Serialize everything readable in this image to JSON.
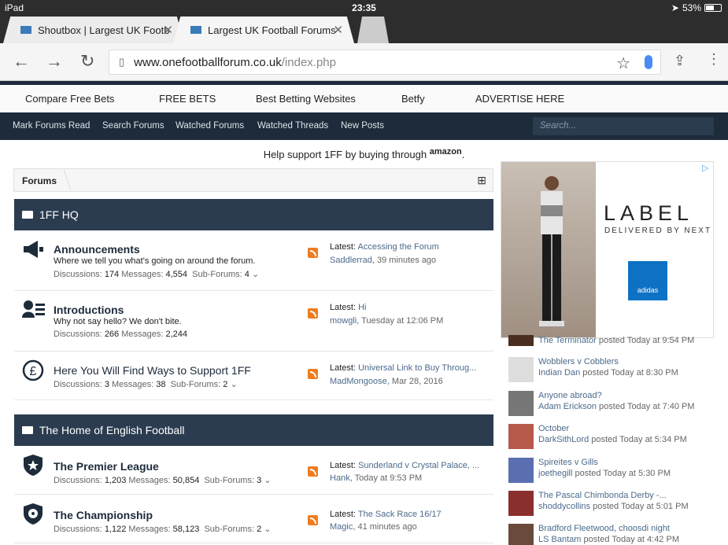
{
  "status_bar": {
    "device": "iPad",
    "time": "23:35",
    "battery": "53%"
  },
  "tabs": [
    {
      "label": "Shoutbox | Largest UK Footb",
      "active": false
    },
    {
      "label": "Largest UK Football Forums",
      "active": true
    }
  ],
  "address": {
    "host": "www.onefootballforum.co.uk",
    "path": "/index.php"
  },
  "sponsor_links": [
    "Compare Free Bets",
    "FREE BETS",
    "Best Betting Websites",
    "Betfy",
    "ADVERTISE HERE"
  ],
  "forum_nav": {
    "links": [
      "Mark Forums Read",
      "Search Forums",
      "Watched Forums",
      "Watched Threads",
      "New Posts"
    ],
    "search_placeholder": "Search..."
  },
  "support": {
    "text": "Help support 1FF by buying through",
    "brand": "amazon",
    "suffix": "."
  },
  "breadcrumb": {
    "label": "Forums"
  },
  "categories": [
    {
      "title": "1FF HQ",
      "nodes": [
        {
          "title": "Announcements",
          "desc": "Where we tell you what's going on around the forum.",
          "discussions": "174",
          "messages": "4,554",
          "subforums": "4",
          "latest": "Accessing the Forum",
          "by": "Saddlerrad",
          "time": "39 minutes ago"
        },
        {
          "title": "Introductions",
          "desc": "Why not say hello? We don't bite.",
          "discussions": "266",
          "messages": "2,244",
          "subforums": "",
          "latest": "Hi",
          "by": "mowgli",
          "time": "Tuesday at 12:06 PM"
        },
        {
          "title": "Here You Will Find Ways to Support 1FF",
          "desc": "",
          "discussions": "3",
          "messages": "38",
          "subforums": "2",
          "latest": "Universal Link to Buy Throug...",
          "by": "MadMongoose",
          "time": "Mar 28, 2016"
        }
      ]
    },
    {
      "title": "The Home of English Football",
      "nodes": [
        {
          "title": "The Premier League",
          "desc": "",
          "discussions": "1,203",
          "messages": "50,854",
          "subforums": "3",
          "latest": "Sunderland v Crystal Palace, ...",
          "by": "Hank",
          "time": "Today at 9:53 PM"
        },
        {
          "title": "The Championship",
          "desc": "",
          "discussions": "1,122",
          "messages": "58,123",
          "subforums": "2",
          "latest": "The Sack Race 16/17",
          "by": "Magic",
          "time": "41 minutes ago"
        }
      ]
    }
  ],
  "labels": {
    "discussions": "Discussions:",
    "messages": "Messages:",
    "subforums": "Sub-Forums:",
    "latest": "Latest:",
    "posted": "posted"
  },
  "ad": {
    "brand": "LABEL",
    "sub": "DELIVERED BY NEXT",
    "logo": "adidas"
  },
  "activity": [
    {
      "title": "",
      "user": "The Terminator",
      "time": "Today at 9:54 PM"
    },
    {
      "title": "Wobblers v Cobblers",
      "user": "Indian Dan",
      "time": "Today at 8:30 PM"
    },
    {
      "title": "Anyone abroad?",
      "user": "Adam Erickson",
      "time": "Today at 7:40 PM"
    },
    {
      "title": "October",
      "user": "DarkSithLord",
      "time": "Today at 5:34 PM"
    },
    {
      "title": "Spireites v Gills",
      "user": "joethegill",
      "time": "Today at 5:30 PM"
    },
    {
      "title": "The Pascal Chimbonda Derby -...",
      "user": "shoddycollins",
      "time": "Today at 5:01 PM"
    },
    {
      "title": "Bradford Fleetwood, choosdi night",
      "user": "LS Bantam",
      "time": "Today at 4:42 PM"
    }
  ],
  "colors": {
    "nav": "#1d2b3a",
    "category": "#2b3c50",
    "rss": "#f07c1f",
    "link": "#4b6a8c"
  }
}
